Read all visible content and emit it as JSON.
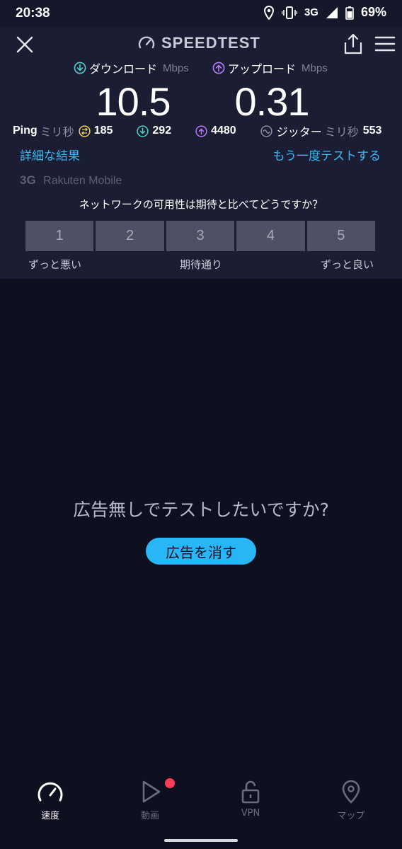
{
  "status_bar": {
    "time": "20:38",
    "network": "3G",
    "battery": "69%"
  },
  "header": {
    "logo_text": "SPEEDTEST"
  },
  "download": {
    "label": "ダウンロード",
    "unit": "Mbps",
    "value": "10.5"
  },
  "upload": {
    "label": "アップロード",
    "unit": "Mbps",
    "value": "0.31"
  },
  "ping": {
    "label": "Ping",
    "unit": "ミリ秒",
    "idle": "185",
    "download": "292",
    "upload": "4480",
    "jitter_label": "ジッター",
    "jitter_unit": "ミリ秒",
    "jitter": "553"
  },
  "links": {
    "details": "詳細な結果",
    "retest": "もう一度テストする"
  },
  "isp": {
    "network": "3G",
    "provider": "Rakuten Mobile"
  },
  "survey": {
    "question": "ネットワークの可用性は期待と比べてどうですか？",
    "options": [
      "1",
      "2",
      "3",
      "4",
      "5"
    ],
    "low_label": "ずっと悪い",
    "mid_label": "期待通り",
    "high_label": "ずっと良い"
  },
  "ad": {
    "prompt": "広告無しでテストしたいですか?",
    "button": "広告を消す"
  },
  "tabs": [
    {
      "label": "速度",
      "icon": "speedometer-icon",
      "active": true
    },
    {
      "label": "動画",
      "icon": "play-icon",
      "active": false
    },
    {
      "label": "VPN",
      "icon": "lock-icon",
      "active": false
    },
    {
      "label": "マップ",
      "icon": "map-pin-icon",
      "active": false
    }
  ],
  "colors": {
    "accent": "#29b6f6",
    "download": "#4fd1c5",
    "upload": "#b57bff",
    "ping_idle": "#f5d35a",
    "notification": "#ff3b5c"
  }
}
